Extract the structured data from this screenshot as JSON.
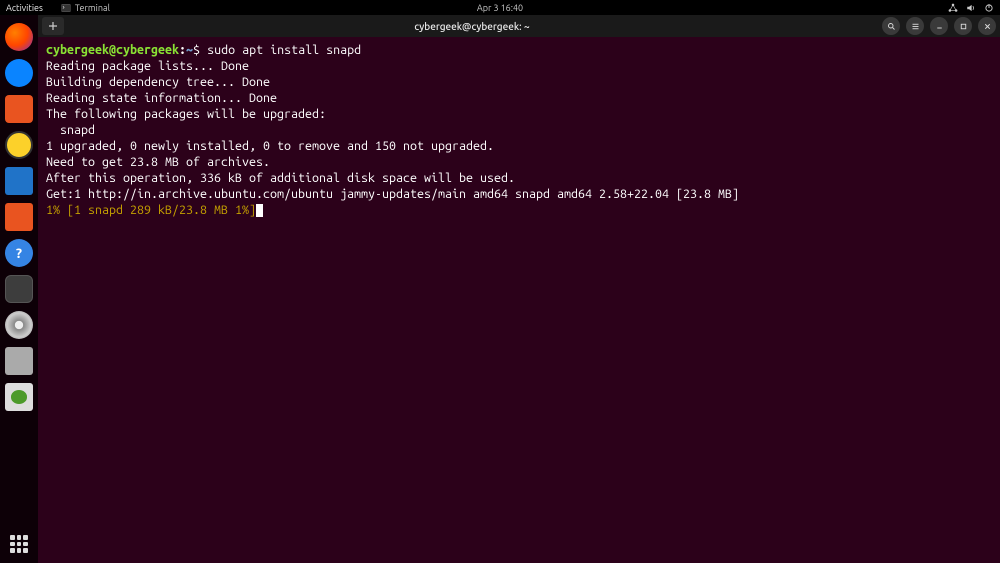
{
  "top_panel": {
    "activities": "Activities",
    "app_label": "Terminal",
    "clock": "Apr 3  16:40"
  },
  "window": {
    "title": "cybergeek@cybergeek: ~"
  },
  "terminal": {
    "prompt_user": "cybergeek@cybergeek",
    "prompt_colon": ":",
    "prompt_path": "~",
    "prompt_dollar": "$ ",
    "command": "sudo apt install snapd",
    "output": [
      "Reading package lists... Done",
      "Building dependency tree... Done",
      "Reading state information... Done",
      "The following packages will be upgraded:",
      "  snapd",
      "1 upgraded, 0 newly installed, 0 to remove and 150 not upgraded.",
      "Need to get 23.8 MB of archives.",
      "After this operation, 336 kB of additional disk space will be used.",
      "Get:1 http://in.archive.ubuntu.com/ubuntu jammy-updates/main amd64 snapd amd64 2.58+22.04 [23.8 MB]"
    ],
    "progress": "1% [1 snapd 289 kB/23.8 MB 1%]"
  },
  "dock": {
    "items": [
      "firefox",
      "thunderbird",
      "files",
      "rhythmbox",
      "writer",
      "software",
      "help",
      "terminal",
      "disk",
      "drive",
      "trash"
    ],
    "help_glyph": "?"
  }
}
